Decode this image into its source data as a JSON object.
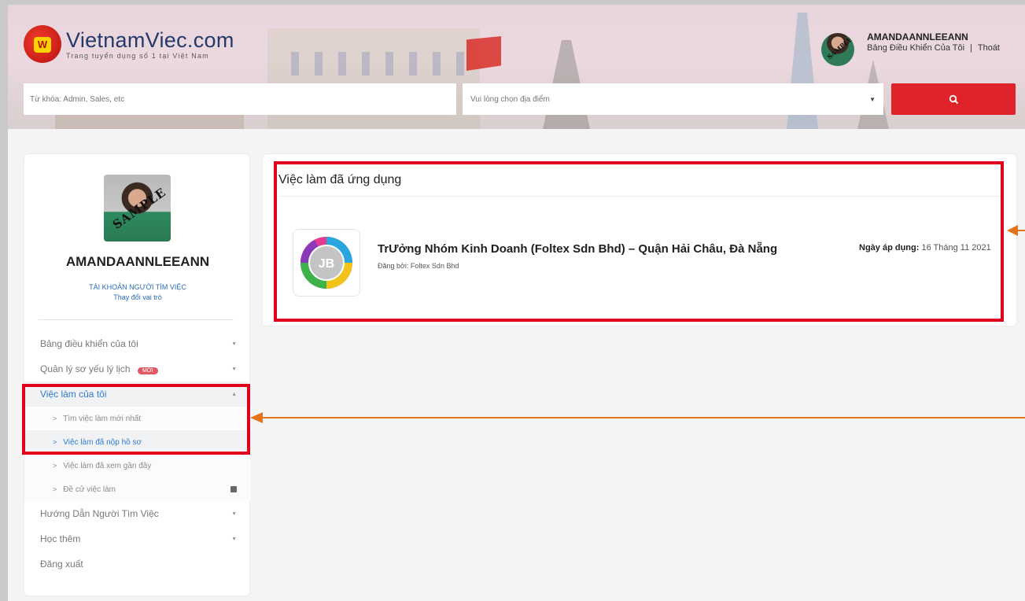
{
  "header": {
    "logo_title": "VietnamViec.com",
    "logo_tagline": "Trang tuyển dụng số 1 tại Việt Nam",
    "logo_mark": "W",
    "user_name": "AMANDAANNLEEANN",
    "dashboard_link": "Bảng Điều Khiển Của Tôi",
    "link_separator": "|",
    "logout_link": "Thoát",
    "avatar_stamp": "SAMPLE"
  },
  "search": {
    "keyword_placeholder": "Từ khóa: Admin, Sales, etc",
    "location_placeholder": "Vui lòng chọn địa điểm",
    "location_chevron": "▼"
  },
  "sidebar": {
    "photo_stamp": "SAMPLE",
    "name": "AMANDAANNLEEANN",
    "role": "TÀI KHOẢN NGƯỜI TÌM VIỆC",
    "switch_role": "Thay đổi vai trò",
    "items": [
      {
        "label": "Bảng điều khiển của tôi",
        "caret": "▼"
      },
      {
        "label": "Quản lý sơ yếu lý lịch",
        "badge": "MỚI",
        "caret": "▼"
      },
      {
        "label": "Việc làm của tôi",
        "caret": "▲"
      }
    ],
    "subitems": [
      {
        "label": "Tìm việc làm mới nhất",
        "arrow": ">"
      },
      {
        "label": "Việc làm đã nộp hồ sơ",
        "arrow": ">"
      },
      {
        "label": "Việc làm đã xem gần đây",
        "arrow": ">"
      },
      {
        "label": "Đề cử việc làm",
        "arrow": ">"
      }
    ],
    "items_after": [
      {
        "label": "Hướng Dẫn Người Tìm Việc",
        "caret": "▼"
      },
      {
        "label": "Học thêm",
        "caret": "▼"
      },
      {
        "label": "Đăng xuất"
      }
    ]
  },
  "main": {
    "section_title": "Việc làm đã ứng dụng",
    "job": {
      "logo_text": "JB",
      "title": "TrƯởng Nhóm Kinh Doanh (Foltex Sdn Bhd) – Quận Hải Châu, Đà Nẵng",
      "posted_by": "Đăng bởi: Foltex Sdn Bhd",
      "date_label": "Ngày áp dụng:",
      "date_value": "16 Tháng 11 2021"
    }
  },
  "colors": {
    "brand_red": "#e0222b",
    "link_blue": "#2f7cc8",
    "annotation_red": "#e0001b",
    "annotation_orange": "#e3741e"
  }
}
